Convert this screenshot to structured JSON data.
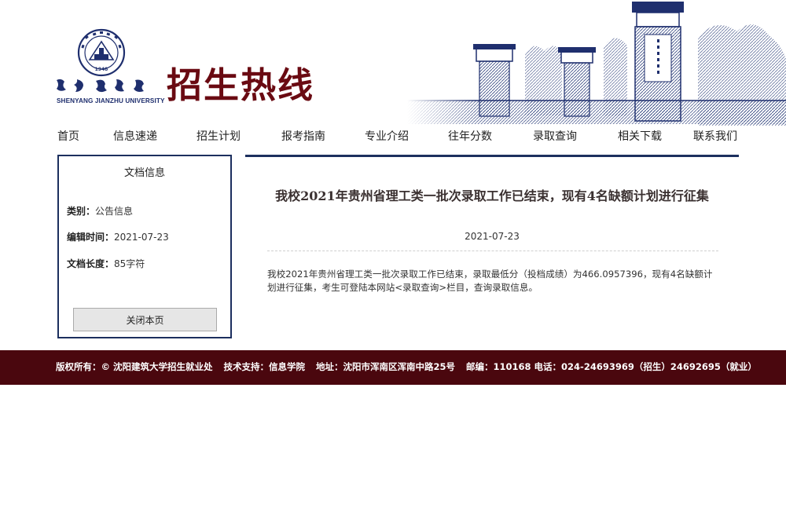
{
  "header": {
    "logo_en": "SHENYANG JIANZHU UNIVERSITY",
    "site_title": "招生热线"
  },
  "nav": {
    "items": [
      "首页",
      "信息速递",
      "招生计划",
      "报考指南",
      "专业介绍",
      "往年分数",
      "录取查询",
      "相关下载",
      "联系我们"
    ]
  },
  "sidebar": {
    "title": "文档信息",
    "category_label": "类别：",
    "category_value": "公告信息",
    "edit_time_label": "编辑时间：",
    "edit_time_value": "2021-07-23",
    "length_label": "文档长度：",
    "length_value": "85字符",
    "close_button": "关闭本页"
  },
  "article": {
    "title": "我校2021年贵州省理工类一批次录取工作已结束，现有4名缺额计划进行征集",
    "date": "2021-07-23",
    "body": "我校2021年贵州省理工类一批次录取工作已结束，录取最低分（投档成绩）为466.0957396，现有4名缺额计划进行征集，考生可登陆本网站<录取查询>栏目，查询录取信息。"
  },
  "footer": {
    "copyright": "版权所有：© 沈阳建筑大学招生就业处",
    "tech": "技术支持：信息学院",
    "address": "地址：沈阳市浑南区浑南中路25号",
    "contact": "邮编：110168 电话：024-24693969（招生）24692695（就业）"
  },
  "colors": {
    "brand_red": "#6a0a12",
    "navy": "#1c2f5e",
    "footer_bg": "#4a070e"
  }
}
